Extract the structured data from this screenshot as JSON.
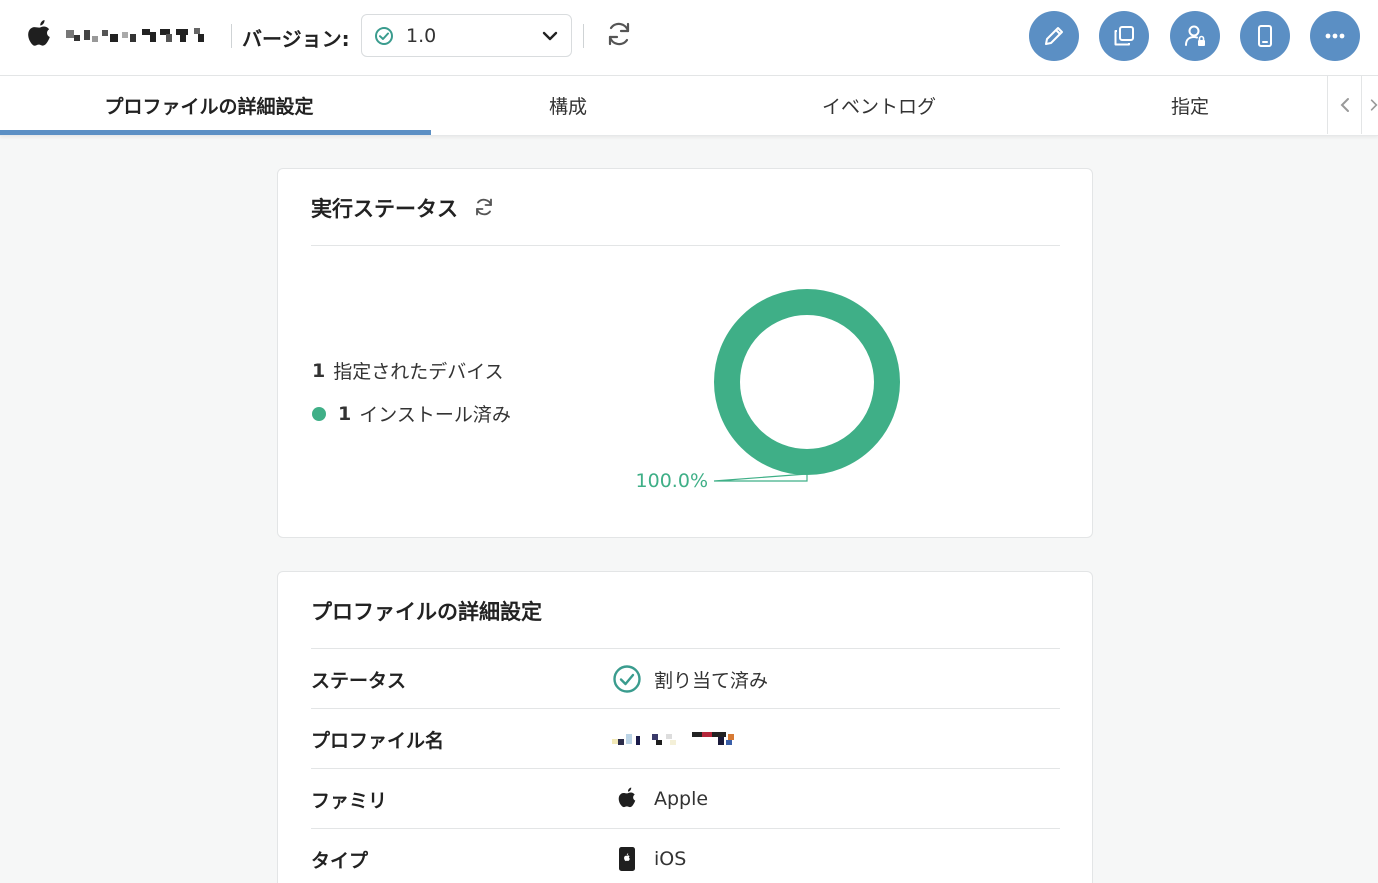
{
  "header": {
    "version_label": "バージョン:",
    "version_value": "1.0",
    "profile_name_redacted": "redacted"
  },
  "tabs": [
    {
      "label": "プロファイルの詳細設定",
      "active": true
    },
    {
      "label": "構成",
      "active": false
    },
    {
      "label": "イベントログ",
      "active": false
    },
    {
      "label": "指定",
      "active": false
    }
  ],
  "status_card": {
    "title": "実行ステータス",
    "assigned_count": "1",
    "assigned_label": "指定されたデバイス",
    "installed_count": "1",
    "installed_label": "インストール済み",
    "percent_label": "100.0%",
    "colors": {
      "installed": "#3faf87"
    }
  },
  "chart_data": {
    "type": "pie",
    "categories": [
      "インストール済み"
    ],
    "values": [
      100.0
    ]
  },
  "details_card": {
    "title": "プロファイルの詳細設定",
    "rows": [
      {
        "label": "ステータス",
        "value": "割り当て済み",
        "icon": "check-circle-icon"
      },
      {
        "label": "プロファイル名",
        "value": "",
        "icon": ""
      },
      {
        "label": "ファミリ",
        "value": "Apple",
        "icon": "apple-icon"
      },
      {
        "label": "タイプ",
        "value": "iOS",
        "icon": "ios-device-icon"
      }
    ]
  },
  "colors": {
    "accent": "#5b8fc4",
    "success": "#3faf87"
  }
}
